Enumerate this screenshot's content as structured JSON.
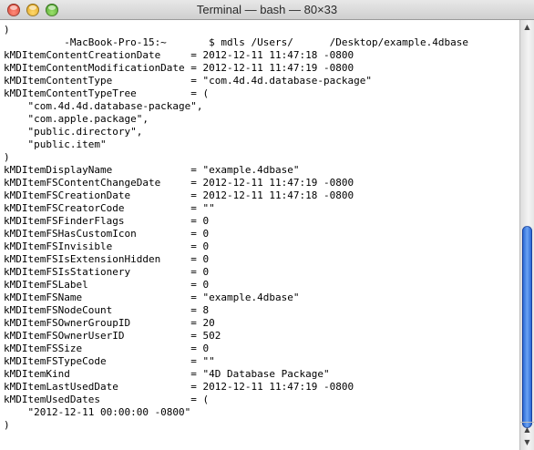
{
  "window": {
    "title": "Terminal — bash — 80×33"
  },
  "scrollbar": {
    "thumb_position_fraction": 0.55
  },
  "terminal": {
    "lines": [
      ")",
      "          -MacBook-Pro-15:~       $ mdls /Users/      /Desktop/example.4dbase",
      "kMDItemContentCreationDate     = 2012-12-11 11:47:18 -0800",
      "kMDItemContentModificationDate = 2012-12-11 11:47:19 -0800",
      "kMDItemContentType             = \"com.4d.4d.database-package\"",
      "kMDItemContentTypeTree         = (",
      "    \"com.4d.4d.database-package\",",
      "    \"com.apple.package\",",
      "    \"public.directory\",",
      "    \"public.item\"",
      ")",
      "kMDItemDisplayName             = \"example.4dbase\"",
      "kMDItemFSContentChangeDate     = 2012-12-11 11:47:19 -0800",
      "kMDItemFSCreationDate          = 2012-12-11 11:47:18 -0800",
      "kMDItemFSCreatorCode           = \"\"",
      "kMDItemFSFinderFlags           = 0",
      "kMDItemFSHasCustomIcon         = 0",
      "kMDItemFSInvisible             = 0",
      "kMDItemFSIsExtensionHidden     = 0",
      "kMDItemFSIsStationery          = 0",
      "kMDItemFSLabel                 = 0",
      "kMDItemFSName                  = \"example.4dbase\"",
      "kMDItemFSNodeCount             = 8",
      "kMDItemFSOwnerGroupID          = 20",
      "kMDItemFSOwnerUserID           = 502",
      "kMDItemFSSize                  = 0",
      "kMDItemFSTypeCode              = \"\"",
      "kMDItemKind                    = \"4D Database Package\"",
      "kMDItemLastUsedDate            = 2012-12-11 11:47:19 -0800",
      "kMDItemUsedDates               = (",
      "    \"2012-12-11 00:00:00 -0800\"",
      ")"
    ]
  },
  "icons": {
    "close": "close-button-icon",
    "minimize": "minimize-button-icon",
    "zoom": "zoom-button-icon",
    "scroll_up": "triangle-up-icon",
    "scroll_down": "triangle-down-icon"
  }
}
